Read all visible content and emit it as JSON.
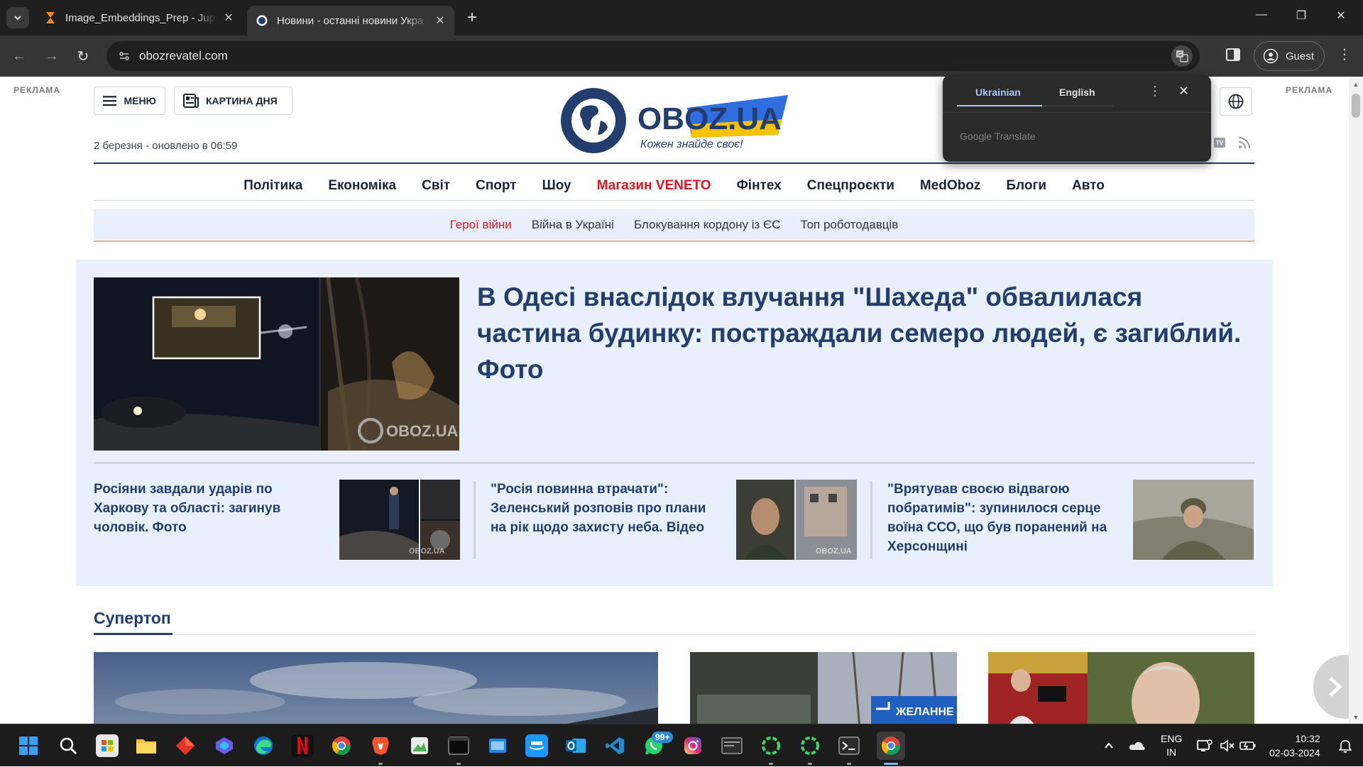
{
  "browser": {
    "tabs": [
      {
        "title": "Image_Embeddings_Prep - Jupy",
        "active": false
      },
      {
        "title": "Новини - останні новини Укра",
        "active": true
      }
    ],
    "url": "obozrevatel.com",
    "guest_label": "Guest"
  },
  "translate_popup": {
    "tab_source": "Ukrainian",
    "tab_target": "English",
    "brand": "Google Translate"
  },
  "page": {
    "ad_label_left": "РЕКЛАМА",
    "ad_label_right": "РЕКЛАМА",
    "menu_label": "МЕНЮ",
    "picture_day_label": "КАРТИНА ДНЯ",
    "logo_text": "OBOZ.UA",
    "logo_slogan": "Кожен знайде своє!",
    "datetime": "2 березня - оновлено в 06:59",
    "main_nav": [
      {
        "label": "Політика",
        "hot": false
      },
      {
        "label": "Економіка",
        "hot": false
      },
      {
        "label": "Світ",
        "hot": false
      },
      {
        "label": "Спорт",
        "hot": false
      },
      {
        "label": "Шоу",
        "hot": false
      },
      {
        "label": "Магазин VENETO",
        "hot": true
      },
      {
        "label": "Фінтех",
        "hot": false
      },
      {
        "label": "Спецпроєкти",
        "hot": false
      },
      {
        "label": "MedOboz",
        "hot": false
      },
      {
        "label": "Блоги",
        "hot": false
      },
      {
        "label": "Авто",
        "hot": false
      }
    ],
    "sub_nav": [
      {
        "label": "Герої війни",
        "hot": true
      },
      {
        "label": "Війна в Україні",
        "hot": false
      },
      {
        "label": "Блокування кордону із ЄС",
        "hot": false
      },
      {
        "label": "Топ роботодавців",
        "hot": false
      }
    ],
    "lead": {
      "title": "В Одесі внаслідок влучання \"Шахеда\" обвалилася частина будинку: постраждали семеро людей, є загиблий. Фото",
      "watermark": "OBOZ.UA"
    },
    "sub_news": [
      {
        "title": "Росіяни завдали ударів по Харкову та області: загинув чоловік. Фото",
        "watermark": "OBOZ.UA"
      },
      {
        "title": "\"Росія повинна втрачати\": Зеленський розповів про плани на рік щодо захисту неба. Відео",
        "watermark": "OBOZ.UA"
      },
      {
        "title": "\"Врятував своєю відвагою побратимів\": зупинилося серце воїна ССО, що був поранений на Херсонщині"
      }
    ],
    "section_title": "Супертоп",
    "card_sign_text": "ЖЕЛАННЕ"
  },
  "taskbar": {
    "lang_top": "ENG",
    "lang_bottom": "IN",
    "time": "10:32",
    "date": "02-03-2024",
    "whatsapp_badge": "99+",
    "apps": [
      "start",
      "search",
      "store",
      "file-explorer",
      "app-red",
      "copilot",
      "edge",
      "netflix",
      "chrome",
      "brave",
      "app-green",
      "terminal-dark",
      "app-blue",
      "prime-video",
      "outlook",
      "vscode",
      "whatsapp",
      "instagram",
      "app-gray",
      "app-ring-1",
      "app-ring-2",
      "terminal",
      "chrome-active"
    ]
  },
  "colors": {
    "brand_navy": "#233d6e",
    "hot_red": "#d71921",
    "lead_bg": "#e8f1fb",
    "flag_blue": "#2f6ee0",
    "flag_yellow": "#f5c400"
  }
}
